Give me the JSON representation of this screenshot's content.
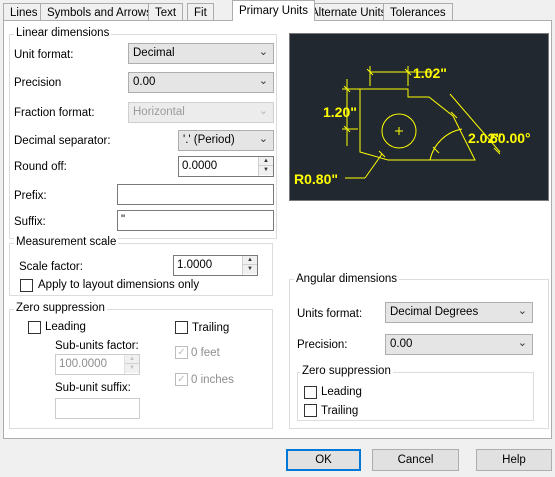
{
  "tabs": [
    "Lines",
    "Symbols and Arrows",
    "Text",
    "Fit",
    "Primary Units",
    "Alternate Units",
    "Tolerances"
  ],
  "active_tab": "Primary Units",
  "linear": {
    "title": "Linear dimensions",
    "unit_format_label": "Unit format:",
    "unit_format_value": "Decimal",
    "precision_label": "Precision",
    "precision_value": "0.00",
    "fraction_label": "Fraction format:",
    "fraction_value": "Horizontal",
    "decimal_sep_label": "Decimal separator:",
    "decimal_sep_value": "'.' (Period)",
    "round_off_label": "Round off:",
    "round_off_value": "0.0000",
    "prefix_label": "Prefix:",
    "prefix_value": "",
    "suffix_label": "Suffix:",
    "suffix_value": "\""
  },
  "measurement": {
    "title": "Measurement scale",
    "scale_label": "Scale factor:",
    "scale_value": "1.0000",
    "apply_layout_label": "Apply to layout dimensions only"
  },
  "zero_linear": {
    "title": "Zero suppression",
    "leading_label": "Leading",
    "trailing_label": "Trailing",
    "subunits_factor_label": "Sub-units factor:",
    "subunits_factor_value": "100.0000",
    "subunit_suffix_label": "Sub-unit suffix:",
    "subunit_suffix_value": "",
    "zero_feet_label": "0 feet",
    "zero_inches_label": "0 inches"
  },
  "angular": {
    "title": "Angular dimensions",
    "units_format_label": "Units format:",
    "units_format_value": "Decimal Degrees",
    "precision_label": "Precision:",
    "precision_value": "0.00",
    "zero_title": "Zero suppression",
    "leading_label": "Leading",
    "trailing_label": "Trailing"
  },
  "preview": {
    "dim_top": "1.02\"",
    "dim_left": "1.20\"",
    "dim_diag": "2.02\"",
    "dim_angle": "60.00°",
    "dim_radius": "R0.80\""
  },
  "buttons": {
    "ok": "OK",
    "cancel": "Cancel",
    "help": "Help"
  },
  "colors": {
    "preview_bg": "#212830",
    "preview_line": "#ffff00",
    "default_button_border": "#0078d7"
  }
}
